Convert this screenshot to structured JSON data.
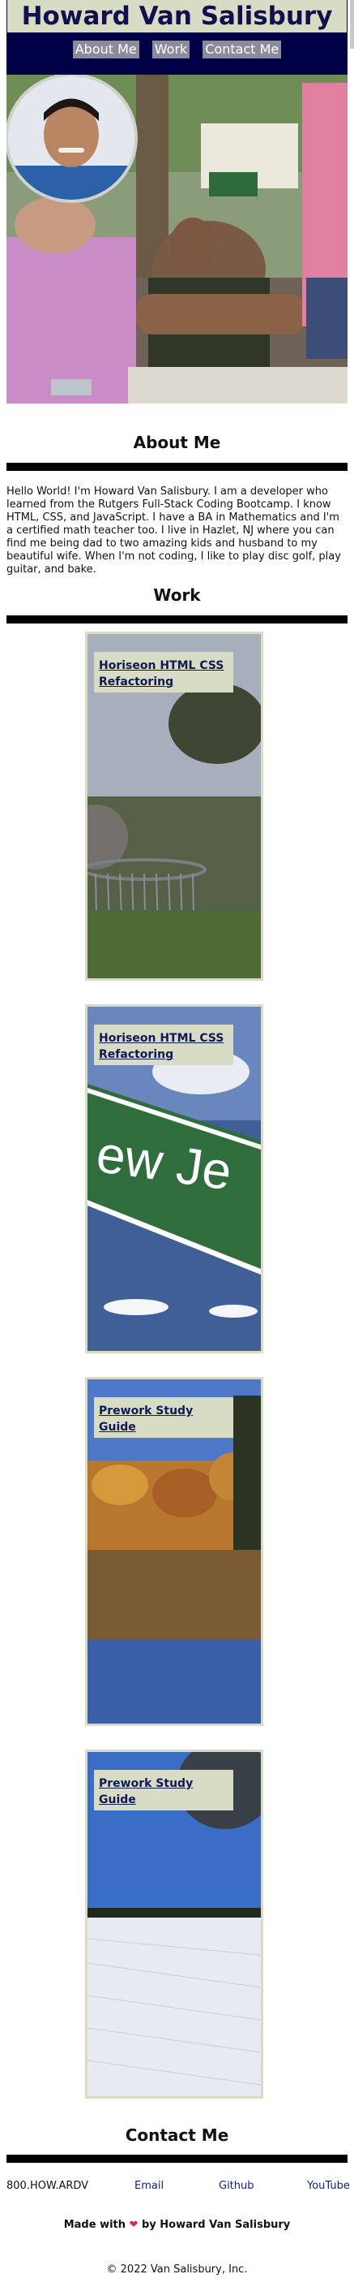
{
  "header": {
    "title": "Howard Van Salisbury",
    "nav": [
      {
        "label": "About Me"
      },
      {
        "label": "Work"
      },
      {
        "label": "Contact Me"
      }
    ]
  },
  "about": {
    "heading": "About Me",
    "text": "Hello World! I'm Howard Van Salisbury. I am a developer who learned from the Rutgers Full-Stack Coding Bootcamp. I know HTML, CSS, and JavaScript. I have a BA in Mathematics and I'm a certified math teacher too. I live in Hazlet, NJ where you can find me being dad to two amazing kids and husband to my beautiful wife. When I'm not coding, I like to play disc golf, play guitar, and bake."
  },
  "work": {
    "heading": "Work",
    "projects": [
      {
        "label": "Horiseon HTML CSS Refactoring"
      },
      {
        "label": "Horiseon HTML CSS Refactoring",
        "image_text": "ew Je"
      },
      {
        "label": "Prework Study Guide"
      },
      {
        "label": "Prework Study Guide"
      }
    ]
  },
  "contact": {
    "heading": "Contact Me",
    "phone": "800.HOW.ARDV",
    "links": [
      {
        "label": "Email"
      },
      {
        "label": "Github"
      },
      {
        "label": "YouTube"
      }
    ]
  },
  "footer": {
    "made_prefix": "Made with",
    "made_suffix": "by Howard Van Salisbury",
    "copyright": "© 2022 Van Salisbury, Inc."
  },
  "colors": {
    "header_bg": "#000046",
    "title_bg": "#d9dcc4",
    "title_text": "#10104e",
    "nav_button": "#8b8b9c",
    "link": "#0a1f9e",
    "heart": "#e0245e"
  }
}
